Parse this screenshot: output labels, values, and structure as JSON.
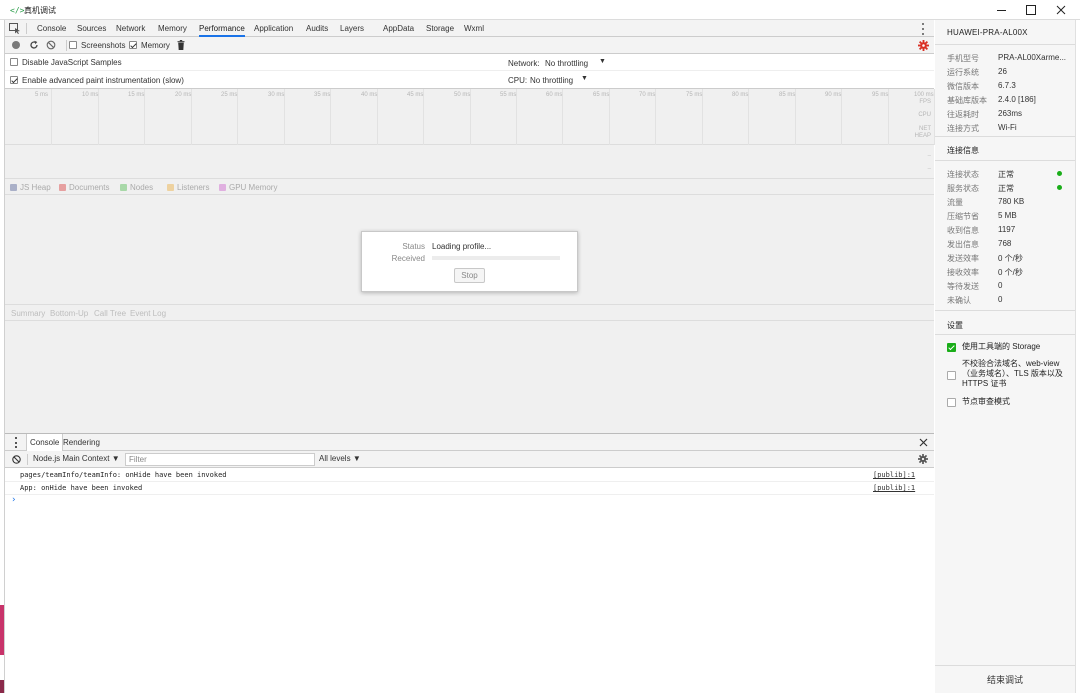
{
  "window": {
    "title": "真机调试",
    "app_icon": "</>"
  },
  "tabs": [
    "Console",
    "Sources",
    "Network",
    "Memory",
    "Performance",
    "Application",
    "Audits",
    "Layers",
    "AppData",
    "Storage",
    "Wxml"
  ],
  "active_tab": "Performance",
  "toolbar": {
    "screenshots_label": "Screenshots",
    "screenshots_checked": false,
    "memory_label": "Memory",
    "memory_checked": true
  },
  "settings": {
    "disable_js_samples_label": "Disable JavaScript Samples",
    "disable_js_samples_checked": false,
    "paint_instrumentation_label": "Enable advanced paint instrumentation (slow)",
    "paint_instrumentation_checked": true,
    "network_label": "Network:",
    "network_value": "No throttling",
    "cpu_label": "CPU:",
    "cpu_value": "No throttling"
  },
  "ruler": {
    "labels": [
      "5 ms",
      "10 ms",
      "15 ms",
      "20 ms",
      "25 ms",
      "30 ms",
      "35 ms",
      "40 ms",
      "45 ms",
      "50 ms",
      "55 ms",
      "60 ms",
      "65 ms",
      "70 ms",
      "75 ms",
      "80 ms",
      "85 ms",
      "90 ms",
      "95 ms",
      "100 ms"
    ],
    "fps_label": "FPS",
    "cpu_label": "CPU",
    "net_label": "NET",
    "heap_label": "HEAP"
  },
  "memory_legend": [
    {
      "label": "JS Heap",
      "color": "#aab0c8"
    },
    {
      "label": "Documents",
      "color": "#e6a0a0"
    },
    {
      "label": "Nodes",
      "color": "#a8d8a8"
    },
    {
      "label": "Listeners",
      "color": "#eed2a0"
    },
    {
      "label": "GPU Memory",
      "color": "#e0b0e0"
    }
  ],
  "bottom_tabs": [
    "Summary",
    "Bottom-Up",
    "Call Tree",
    "Event Log"
  ],
  "dialog": {
    "status_label": "Status",
    "status_value": "Loading profile...",
    "received_label": "Received",
    "received_progress": 0,
    "stop_label": "Stop"
  },
  "drawer": {
    "tabs": [
      "Console",
      "Rendering"
    ],
    "active_tab": "Console",
    "context": "Node.js Main Context",
    "filter_placeholder": "Filter",
    "levels": "All levels"
  },
  "console_logs": [
    {
      "message": "pages/teamInfo/teamInfo: onHide have been invoked",
      "source": "[publib]:1"
    },
    {
      "message": "App: onHide have been invoked",
      "source": "[publib]:1"
    }
  ],
  "prompt_symbol": "›",
  "device": {
    "name": "HUAWEI-PRA-AL00X",
    "info": [
      {
        "key": "手机型号",
        "value": "PRA-AL00Xarme..."
      },
      {
        "key": "运行系统",
        "value": "26"
      },
      {
        "key": "微信版本",
        "value": "6.7.3"
      },
      {
        "key": "基础库版本",
        "value": "2.4.0 [186]"
      },
      {
        "key": "往返耗时",
        "value": "263ms"
      },
      {
        "key": "连接方式",
        "value": "Wi-Fi"
      }
    ]
  },
  "connection": {
    "heading": "连接信息",
    "items": [
      {
        "key": "连接状态",
        "value": "正常",
        "dot": true
      },
      {
        "key": "服务状态",
        "value": "正常",
        "dot": true
      },
      {
        "key": "流量",
        "value": "780 KB",
        "dot": false
      },
      {
        "key": "压缩节省",
        "value": "5 MB",
        "dot": false
      },
      {
        "key": "收到信息",
        "value": "1197",
        "dot": false
      },
      {
        "key": "发出信息",
        "value": "768",
        "dot": false
      },
      {
        "key": "发送效率",
        "value": "0 个/秒",
        "dot": false
      },
      {
        "key": "接收效率",
        "value": "0 个/秒",
        "dot": false
      },
      {
        "key": "等待发送",
        "value": "0",
        "dot": false
      },
      {
        "key": "未确认",
        "value": "0",
        "dot": false
      }
    ],
    "status_color": "#1aad19"
  },
  "settings_panel": {
    "heading": "设置",
    "options": [
      {
        "label": "使用工具端的 Storage",
        "checked": true
      },
      {
        "label": "不校验合法域名、web-view（业务域名）、TLS 版本以及 HTTPS 证书",
        "checked": false
      },
      {
        "label": "节点审查模式",
        "checked": false
      }
    ]
  },
  "end_button": "结束调试",
  "colors": {
    "accent": "#1a73e8",
    "record_red": "#d93025",
    "wechat_green": "#1aad19"
  }
}
